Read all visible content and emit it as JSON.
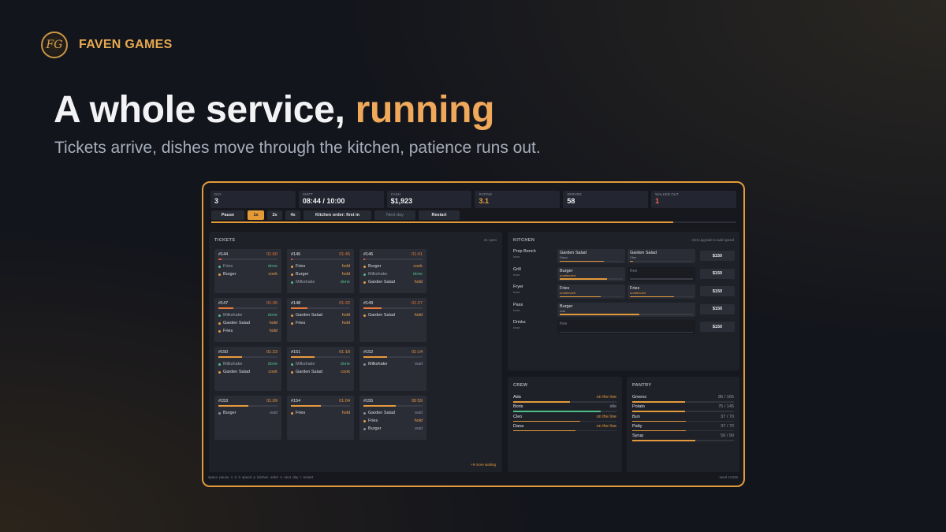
{
  "brand": {
    "logo": "FG",
    "name": "FAVEN GAMES"
  },
  "hero": {
    "title_start": "A whole service, ",
    "title_accent": "running",
    "subtitle": "Tickets arrive, dishes move through the kitchen, patience runs out."
  },
  "stats": [
    {
      "label": "DAY",
      "value": "3",
      "tone": "normal"
    },
    {
      "label": "SHIFT",
      "value": "08:44 / 10:00",
      "tone": "normal"
    },
    {
      "label": "CASH",
      "value": "$1,923",
      "tone": "normal"
    },
    {
      "label": "RATING",
      "value": "3.1",
      "tone": "orange"
    },
    {
      "label": "SERVED",
      "value": "58",
      "tone": "normal"
    },
    {
      "label": "WALKED OUT",
      "value": "1",
      "tone": "red"
    }
  ],
  "controls": {
    "pause": "Pause",
    "speed_1": "1x",
    "speed_2": "2x",
    "speed_4": "4x",
    "kitchen_order": "Kitchen order: first in",
    "next_day": "Next day",
    "restart": "Restart",
    "active_speed": "1x",
    "shift_progress": 0.88
  },
  "tickets_panel": {
    "title": "TICKETS",
    "open_count": "21 open",
    "more_waiting": "+9 more waiting",
    "tickets": [
      {
        "id": "#144",
        "time": "01:50",
        "time_color": "#e5793a",
        "patience": 0.05,
        "bar_color": "#e35a3a",
        "items": [
          {
            "name": "Fries",
            "status": "done"
          },
          {
            "name": "Burger",
            "status": "cook"
          }
        ]
      },
      {
        "id": "#145",
        "time": "01:45",
        "time_color": "#e5793a",
        "patience": 0.03,
        "bar_color": "#e35a3a",
        "items": [
          {
            "name": "Fries",
            "status": "hold"
          },
          {
            "name": "Burger",
            "status": "hold"
          },
          {
            "name": "Milkshake",
            "status": "done"
          }
        ]
      },
      {
        "id": "#146",
        "time": "01:41",
        "time_color": "#e5793a",
        "patience": 0.02,
        "bar_color": "#e35a3a",
        "items": [
          {
            "name": "Burger",
            "status": "cook"
          },
          {
            "name": "Milkshake",
            "status": "done"
          },
          {
            "name": "Garden Salad",
            "status": "hold"
          }
        ]
      },
      {
        "id": "#147",
        "time": "01:36",
        "time_color": "#e5793a",
        "patience": 0.25,
        "bar_color": "#e5793a",
        "items": [
          {
            "name": "Milkshake",
            "status": "done"
          },
          {
            "name": "Garden Salad",
            "status": "hold"
          },
          {
            "name": "Fries",
            "status": "hold"
          }
        ]
      },
      {
        "id": "#148",
        "time": "01:32",
        "time_color": "#e5793a",
        "patience": 0.28,
        "bar_color": "#e5793a",
        "items": [
          {
            "name": "Garden Salad",
            "status": "hold"
          },
          {
            "name": "Fries",
            "status": "hold"
          }
        ]
      },
      {
        "id": "#149",
        "time": "01:27",
        "time_color": "#e5793a",
        "patience": 0.3,
        "bar_color": "#e5793a",
        "items": [
          {
            "name": "Garden Salad",
            "status": "hold"
          }
        ]
      },
      {
        "id": "#150",
        "time": "01:23",
        "time_color": "#e89a3c",
        "patience": 0.4,
        "bar_color": "#e89a3c",
        "items": [
          {
            "name": "Milkshake",
            "status": "done"
          },
          {
            "name": "Garden Salad",
            "status": "cook"
          }
        ]
      },
      {
        "id": "#151",
        "time": "01:18",
        "time_color": "#e89a3c",
        "patience": 0.4,
        "bar_color": "#e89a3c",
        "items": [
          {
            "name": "Milkshake",
            "status": "done"
          },
          {
            "name": "Garden Salad",
            "status": "cook"
          }
        ]
      },
      {
        "id": "#152",
        "time": "01:14",
        "time_color": "#e89a3c",
        "patience": 0.4,
        "bar_color": "#e89a3c",
        "items": [
          {
            "name": "Milkshake",
            "status": "wait"
          }
        ]
      },
      {
        "id": "#153",
        "time": "01:09",
        "time_color": "#e89a3c",
        "patience": 0.5,
        "bar_color": "#e89a3c",
        "items": [
          {
            "name": "Burger",
            "status": "wait"
          }
        ]
      },
      {
        "id": "#154",
        "time": "01:04",
        "time_color": "#e89a3c",
        "patience": 0.5,
        "bar_color": "#e89a3c",
        "items": [
          {
            "name": "Fries",
            "status": "hold"
          }
        ]
      },
      {
        "id": "#155",
        "time": "00:59",
        "time_color": "#e89a3c",
        "patience": 0.55,
        "bar_color": "#e89a3c",
        "items": [
          {
            "name": "Garden Salad",
            "status": "wait"
          },
          {
            "name": "Fries",
            "status": "hold"
          },
          {
            "name": "Burger",
            "status": "wait"
          }
        ]
      }
    ]
  },
  "kitchen_panel": {
    "title": "KITCHEN",
    "note": "click upgrade to add speed",
    "stations": [
      {
        "name": "Prep Bench",
        "sub": "base",
        "price": "$150",
        "slots": [
          {
            "dish": "Garden Salad",
            "cook": "Dana",
            "progress": 0.7,
            "free": false,
            "warn": false
          },
          {
            "dish": "Garden Salad",
            "cook": "Cleo",
            "progress": 0.05,
            "free": false,
            "warn": false
          }
        ]
      },
      {
        "name": "Grill",
        "sub": "base",
        "price": "$150",
        "slots": [
          {
            "dish": "Burger",
            "cook": "unattended",
            "progress": 0.75,
            "free": false,
            "warn": true
          },
          {
            "dish": "free",
            "cook": "",
            "progress": 0,
            "free": true,
            "warn": false
          }
        ]
      },
      {
        "name": "Fryer",
        "sub": "base",
        "price": "$150",
        "slots": [
          {
            "dish": "Fries",
            "cook": "unattended",
            "progress": 0.65,
            "free": false,
            "warn": true
          },
          {
            "dish": "Fries",
            "cook": "unattended",
            "progress": 0.7,
            "free": false,
            "warn": true
          }
        ]
      },
      {
        "name": "Pass",
        "sub": "base",
        "price": "$150",
        "slots": [
          {
            "dish": "Burger",
            "cook": "Ada",
            "progress": 0.6,
            "free": false,
            "warn": false
          }
        ]
      },
      {
        "name": "Drinks",
        "sub": "base",
        "price": "$150",
        "slots": [
          {
            "dish": "free",
            "cook": "",
            "progress": 0,
            "free": true,
            "warn": false
          }
        ]
      }
    ]
  },
  "crew_panel": {
    "title": "CREW",
    "members": [
      {
        "name": "Ada",
        "status": "on the line",
        "level": 0.55,
        "tone": "orange"
      },
      {
        "name": "Boris",
        "status": "idle",
        "level": 0.85,
        "tone": "green"
      },
      {
        "name": "Cleo",
        "status": "on the line",
        "level": 0.65,
        "tone": "orange"
      },
      {
        "name": "Dana",
        "status": "on the line",
        "level": 0.6,
        "tone": "orange"
      }
    ]
  },
  "pantry_panel": {
    "title": "PANTRY",
    "items": [
      {
        "name": "Greens",
        "count": "86 / 165",
        "level": 0.52
      },
      {
        "name": "Potato",
        "count": "75 / 145",
        "level": 0.52
      },
      {
        "name": "Bun",
        "count": "37 / 70",
        "level": 0.53
      },
      {
        "name": "Patty",
        "count": "37 / 70",
        "level": 0.53
      },
      {
        "name": "Syrup",
        "count": "56 / 90",
        "level": 0.62
      }
    ]
  },
  "footer": {
    "shortcuts": "space pause   1 2 3 speed   p kitchen order   n next day   r restart",
    "seed": "seed 12345"
  },
  "colors": {
    "accent": "#e59a38",
    "done": "#4ebd89",
    "danger": "#ee6a5a"
  }
}
